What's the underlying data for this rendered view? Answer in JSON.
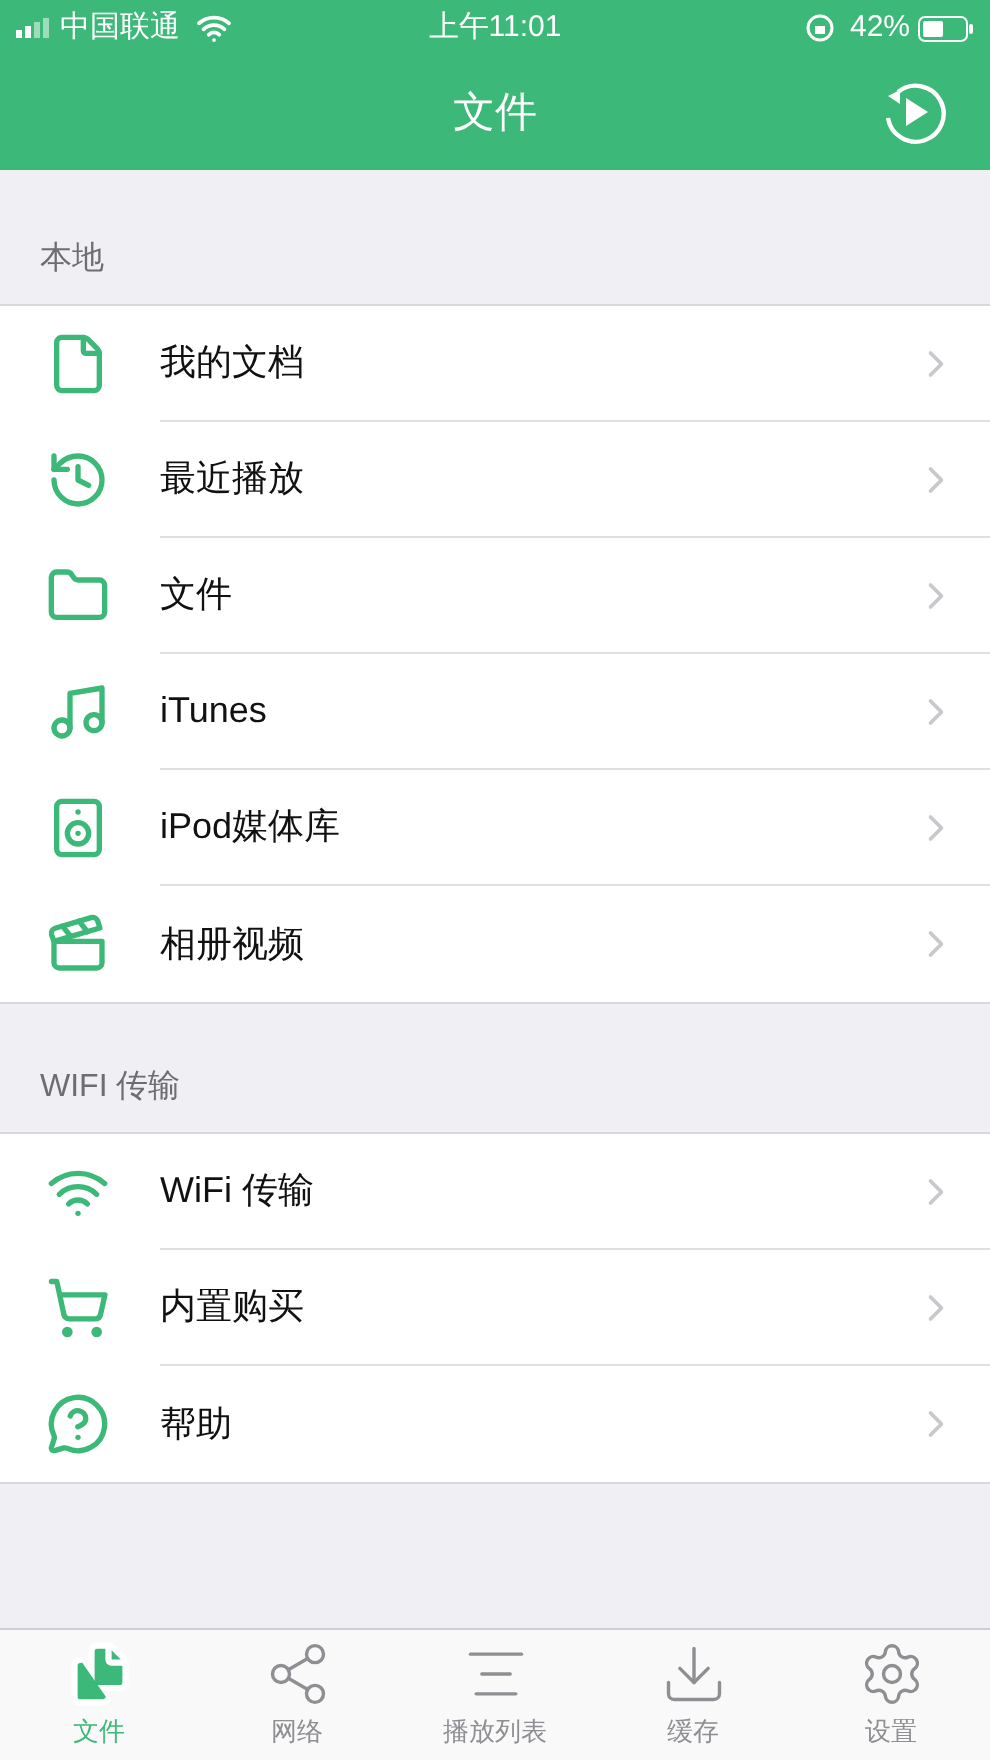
{
  "status_bar": {
    "carrier": "中国联通",
    "time": "上午11:01",
    "battery": "42%"
  },
  "nav": {
    "title": "文件"
  },
  "sections": [
    {
      "header": "本地",
      "items": [
        {
          "kind": "document",
          "label": "我的文档"
        },
        {
          "kind": "history",
          "label": "最近播放"
        },
        {
          "kind": "folder",
          "label": "文件"
        },
        {
          "kind": "music",
          "label": "iTunes"
        },
        {
          "kind": "speaker",
          "label": "iPod媒体库"
        },
        {
          "kind": "video",
          "label": "相册视频"
        }
      ]
    },
    {
      "header": "WIFI 传输",
      "items": [
        {
          "kind": "wifi",
          "label": "WiFi 传输"
        },
        {
          "kind": "cart",
          "label": "内置购买"
        },
        {
          "kind": "help",
          "label": "帮助"
        }
      ]
    }
  ],
  "tabs": [
    {
      "kind": "files",
      "label": "文件",
      "selected": true
    },
    {
      "kind": "network",
      "label": "网络",
      "selected": false
    },
    {
      "kind": "playlist",
      "label": "播放列表",
      "selected": false
    },
    {
      "kind": "download",
      "label": "缓存",
      "selected": false
    },
    {
      "kind": "settings",
      "label": "设置",
      "selected": false
    }
  ]
}
